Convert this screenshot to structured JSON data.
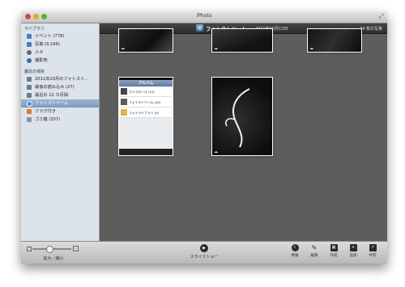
{
  "window": {
    "title": "iPhoto"
  },
  "sidebar": {
    "library_heading": "ライブラリ",
    "library_items": [
      {
        "label": "イベント (778)",
        "icon": "events-icon",
        "color": "#4a7dc0"
      },
      {
        "label": "写真 (9,196)",
        "icon": "photos-icon",
        "color": "#4a7dc0"
      },
      {
        "label": "人々",
        "icon": "faces-icon",
        "color": "#5b6b7d"
      },
      {
        "label": "撮影地",
        "icon": "places-icon",
        "color": "#3d6aa5"
      }
    ],
    "recent_heading": "最近の項目",
    "recent_items": [
      {
        "label": "2011年10月のフォトスト…",
        "icon": "calendar-icon",
        "color": "#6a7c90",
        "selected": false
      },
      {
        "label": "最後の読み込み (27)",
        "icon": "import-icon",
        "color": "#6a7c90",
        "selected": false
      },
      {
        "label": "最近の 12 カ月間",
        "icon": "calendar-icon",
        "color": "#6a7c90",
        "selected": false
      },
      {
        "label": "フォトストリーム",
        "icon": "photostream-icon",
        "color": "#3b8be0",
        "selected": true
      },
      {
        "label": "フラグ付き",
        "icon": "flag-icon",
        "color": "#e07b20",
        "selected": false
      },
      {
        "label": "ゴミ箱 (207)",
        "icon": "trash-icon",
        "color": "#8a96a5",
        "selected": false
      }
    ]
  },
  "toolbar": {
    "title": "フォトストリーム",
    "date": "2011年10月13日",
    "count": "44 枚の写真"
  },
  "phone_screenshot": {
    "nav_title": "アルバム",
    "rows": [
      {
        "label": "カメラロール (10)"
      },
      {
        "label": "フォトストリーム (44)"
      },
      {
        "label": "フォトライブラリ (9)"
      }
    ]
  },
  "bottombar": {
    "zoom_label": "拡大／縮小",
    "slideshow_label": "スライドショー",
    "info_label": "情報",
    "edit_label": "編集",
    "create_label": "作成",
    "add_label": "追加",
    "share_label": "共有"
  },
  "colors": {
    "content_bg": "#5d5d5d",
    "toolbar_bg": "#3a3a3a",
    "sidebar_bg": "#dde3ea",
    "selection": "#8aa4c6"
  }
}
